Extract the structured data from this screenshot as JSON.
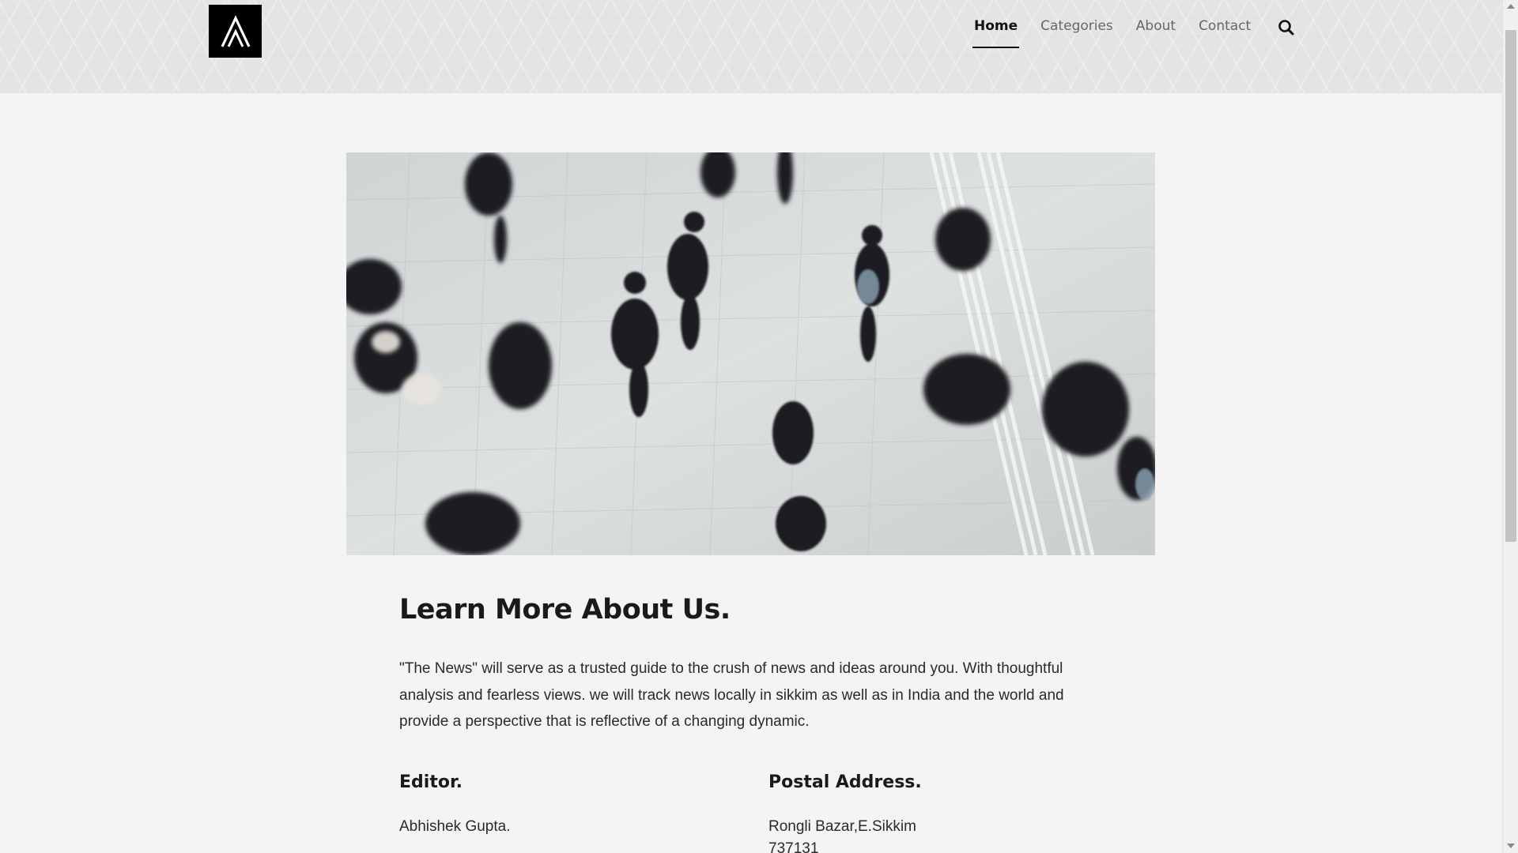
{
  "nav": {
    "items": [
      {
        "label": "Home",
        "active": true
      },
      {
        "label": "Categories",
        "active": false
      },
      {
        "label": "About",
        "active": false
      },
      {
        "label": "Contact",
        "active": false
      }
    ],
    "search_icon": "search-icon"
  },
  "logo": {
    "icon": "triangle-chevron-logo"
  },
  "hero": {
    "subject": "crowd-of-people-walking-aerial-view"
  },
  "about": {
    "title": "Learn More About Us.",
    "intro": "\"The News\" will serve as a trusted guide to the crush of news and ideas around you. With thoughtful analysis and fearless views. we will track news locally in sikkim as well as in India and the world and provide a perspective that is reflective of a changing dynamic."
  },
  "editor": {
    "heading": "Editor.",
    "name": "Abhishek Gupta."
  },
  "address": {
    "heading": "Postal Address.",
    "line1": "Rongli Bazar,E.Sikkim",
    "line2": "737131"
  },
  "colors": {
    "background": "#f4f4f4",
    "header_bg": "#e4e4e4",
    "text": "#222222",
    "accent": "#111111"
  }
}
